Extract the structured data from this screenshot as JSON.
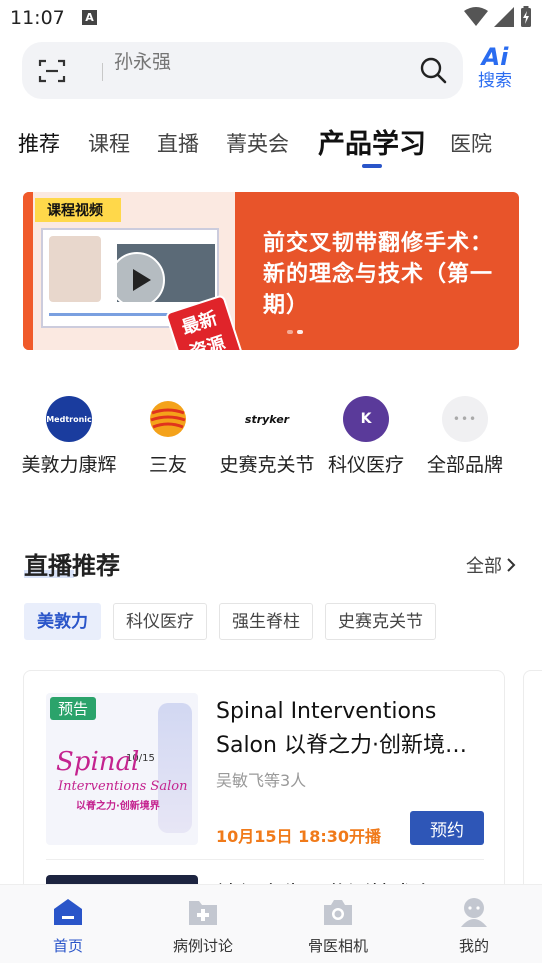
{
  "status_bar": {
    "time": "11:07",
    "notification_letter": "A"
  },
  "search": {
    "placeholder": "孙永强"
  },
  "ai_search": {
    "glyph": "Ai",
    "label": "搜索"
  },
  "tabs": [
    {
      "label": "推荐"
    },
    {
      "label": "课程"
    },
    {
      "label": "直播"
    },
    {
      "label": "菁英会"
    },
    {
      "label": "产品学习"
    },
    {
      "label": "医院"
    }
  ],
  "selected_tab": "产品学习",
  "banner": {
    "tag": "课程视频",
    "badge": "最新资源",
    "title": "前交叉韧带翻修手术：新的理念与技术（第一期）"
  },
  "brands": [
    {
      "label": "美敦力康辉",
      "logo_text": "Medtronic"
    },
    {
      "label": "三友",
      "logo_text": ""
    },
    {
      "label": "史赛克关节",
      "logo_text": "stryker"
    },
    {
      "label": "科仪医疗",
      "logo_text": "K"
    },
    {
      "label": "全部品牌",
      "logo_text": "•••"
    }
  ],
  "live_section": {
    "title": "直播推荐",
    "more_label": "全部",
    "chips": [
      "美敦力",
      "科仪医疗",
      "强生脊柱",
      "史赛克关节"
    ],
    "active_chip": "美敦力"
  },
  "live_card": {
    "badge": "预告",
    "poster_title": "Spinal",
    "poster_subtitle": "Interventions Salon",
    "poster_date": "10/15",
    "poster_cn": "以脊之力·创新境界",
    "title": "Spinal Interventions Salon 以脊之力·创新境…",
    "speakers": "吴敏飞等3人",
    "time": "10月15日 18:30开播",
    "button_label": "预约",
    "next_title": "神经电生理监测技术在"
  },
  "bottom_nav": [
    {
      "label": "首页",
      "icon": "home-icon",
      "active": true
    },
    {
      "label": "病例讨论",
      "icon": "case-folder-icon",
      "active": false
    },
    {
      "label": "骨医相机",
      "icon": "camera-icon",
      "active": false
    },
    {
      "label": "我的",
      "icon": "profile-icon",
      "active": false
    }
  ],
  "colors": {
    "accent": "#2a55c9",
    "banner": "#e8542a",
    "time_orange": "#f07a1a",
    "preview_green": "#2ba36b"
  }
}
